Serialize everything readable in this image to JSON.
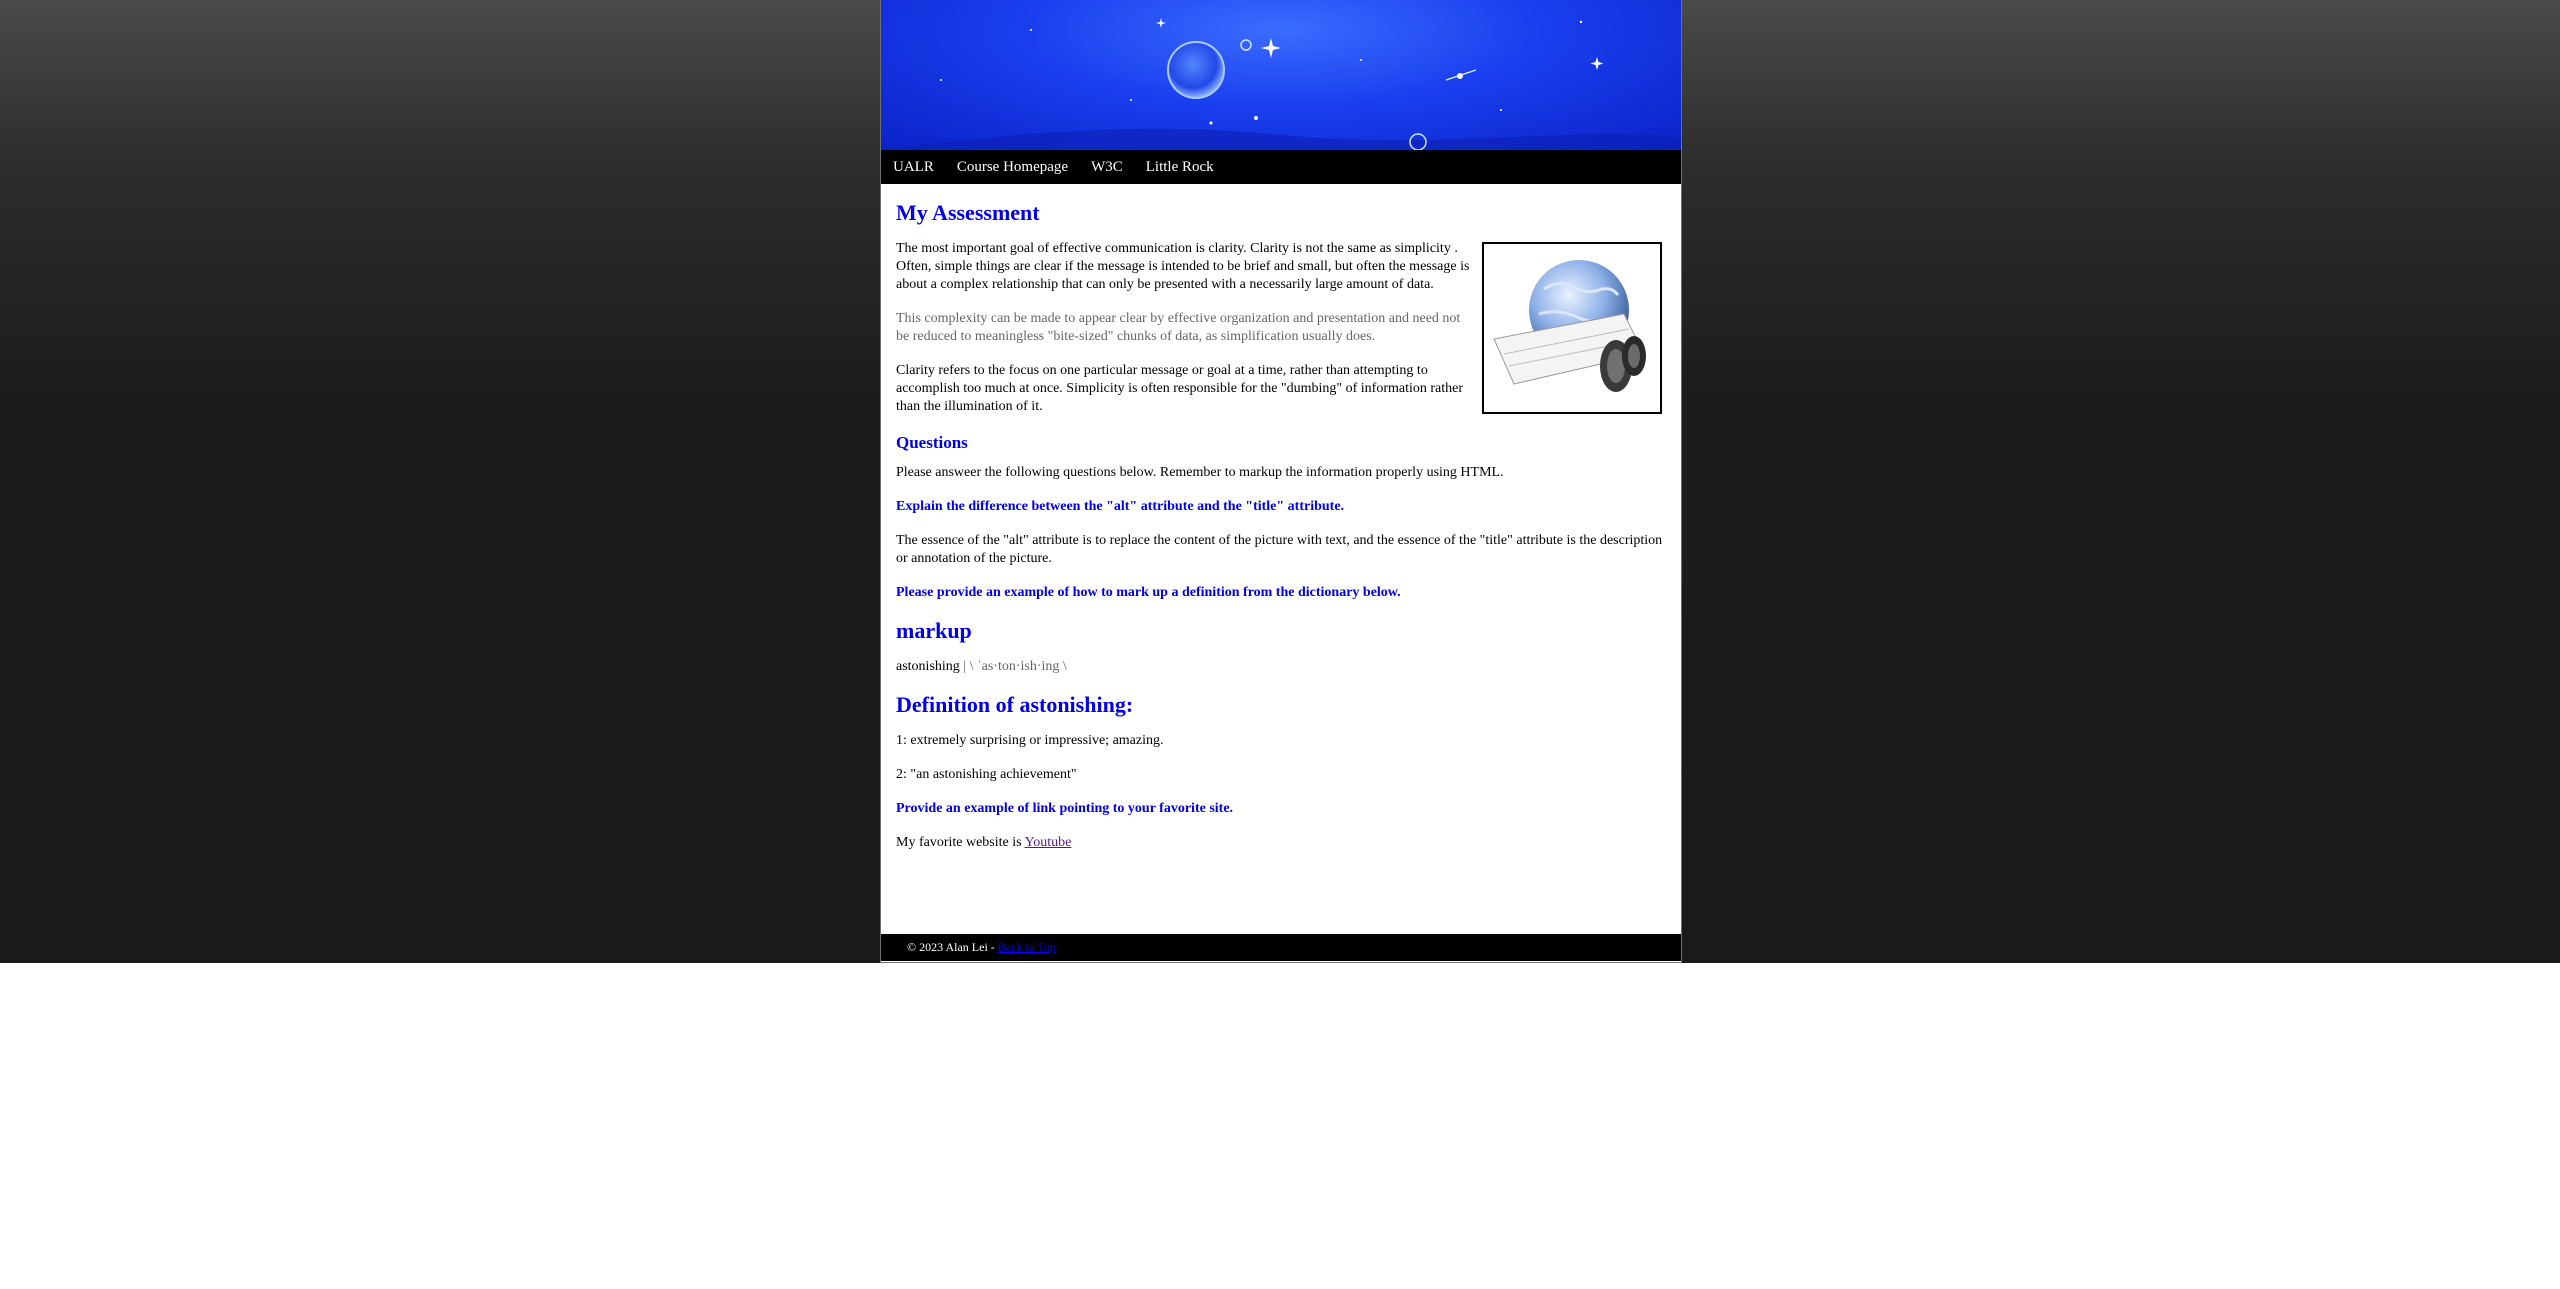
{
  "nav": {
    "items": [
      {
        "label": "UALR"
      },
      {
        "label": "Course Homepage"
      },
      {
        "label": "W3C"
      },
      {
        "label": "Little Rock"
      }
    ]
  },
  "assessment": {
    "heading": "My Assessment",
    "para1": "The most important goal of effective communication is clarity. Clarity is not the same as simplicity . Often, simple things are clear if the message is intended to be brief and small, but often the message is about a complex relationship that can only be presented with a necessarily large amount of data.",
    "para2": "This complexity can be made to appear clear by effective organization and presentation and need not be reduced to meaningless \"bite-sized\" chunks of data, as simplification usually does.",
    "para3": "Clarity refers to the focus on one particular message or goal at a time, rather than attempting to accomplish too much at once. Simplicity is often responsible for the \"dumbing\" of information rather than the illumination of it."
  },
  "questions": {
    "heading": "Questions",
    "intro": "Please answeer the following questions below. Remember to markup the information properly using HTML.",
    "q1": "Explain the difference between the \"alt\" attribute and the \"title\" attribute.",
    "a1": "The essence of the \"alt\" attribute is to replace the content of the picture with text, and the essence of the \"title\" attribute is the description or annotation of the picture.",
    "q2": "Please provide an example of how to mark up a definition from the dictionary below."
  },
  "markup": {
    "heading": "markup",
    "word": "astonishing",
    "separator": " | ",
    "pronunciation": "\\ ˈas·ton·ish·ing \\"
  },
  "definition": {
    "heading": "Definition of astonishing:",
    "def1": "1: extremely surprising or impressive; amazing.",
    "def2": "2: \"an astonishing achievement\""
  },
  "link_section": {
    "question": "Provide an example of link pointing to your favorite site.",
    "prefix": "My favorite website is ",
    "link_label": "Youtube"
  },
  "footer": {
    "text": "© 2023 Alan Lei - ",
    "back_label": "Back to Top"
  },
  "colors": {
    "heading": "#0000e6",
    "banner": "#1a3fee",
    "nav_bg": "#000000"
  }
}
